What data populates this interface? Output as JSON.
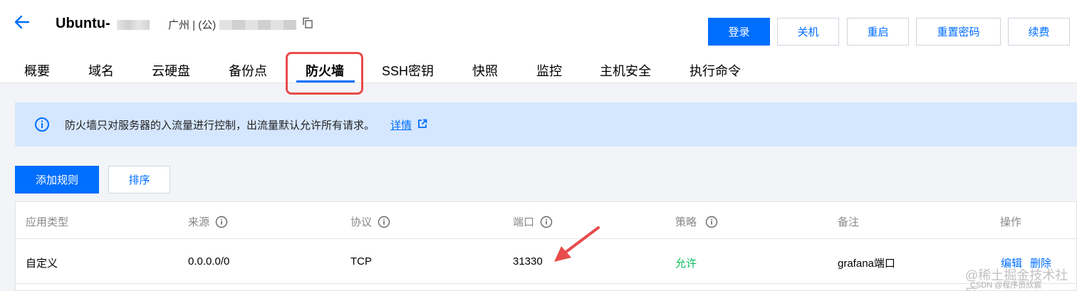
{
  "header": {
    "instance_name": "Ubuntu-",
    "region": "广州 | (公)",
    "buttons": {
      "login": "登录",
      "shutdown": "关机",
      "restart": "重启",
      "reset_password": "重置密码",
      "renew": "续费"
    }
  },
  "tabs": [
    {
      "label": "概要"
    },
    {
      "label": "域名"
    },
    {
      "label": "云硬盘"
    },
    {
      "label": "备份点"
    },
    {
      "label": "防火墙",
      "active": true
    },
    {
      "label": "SSH密钥"
    },
    {
      "label": "快照"
    },
    {
      "label": "监控"
    },
    {
      "label": "主机安全"
    },
    {
      "label": "执行命令"
    }
  ],
  "notice": {
    "text": "防火墙只对服务器的入流量进行控制，出流量默认允许所有请求。",
    "link": "详情"
  },
  "toolbar": {
    "add_rule": "添加规则",
    "sort": "排序"
  },
  "table": {
    "columns": [
      "应用类型",
      "来源",
      "协议",
      "端口",
      "策略",
      "备注",
      "操作"
    ],
    "rows": [
      {
        "app_type": "自定义",
        "source": "0.0.0.0/0",
        "protocol": "TCP",
        "port": "31330",
        "policy": "允许",
        "note": "grafana端口",
        "actions": [
          "编辑",
          "删除"
        ]
      }
    ]
  },
  "watermarks": {
    "main": "@稀土掘金技术社区",
    "sub": "CSDN @程序员欣宸"
  },
  "colors": {
    "accent": "#006eff",
    "allow": "#0abf5b",
    "notice_bg": "#d5e7ff",
    "highlight": "#e84c4c"
  },
  "icons": [
    "back-arrow-icon",
    "copy-icon",
    "info-icon",
    "external-link-icon",
    "help-circle-icon"
  ]
}
